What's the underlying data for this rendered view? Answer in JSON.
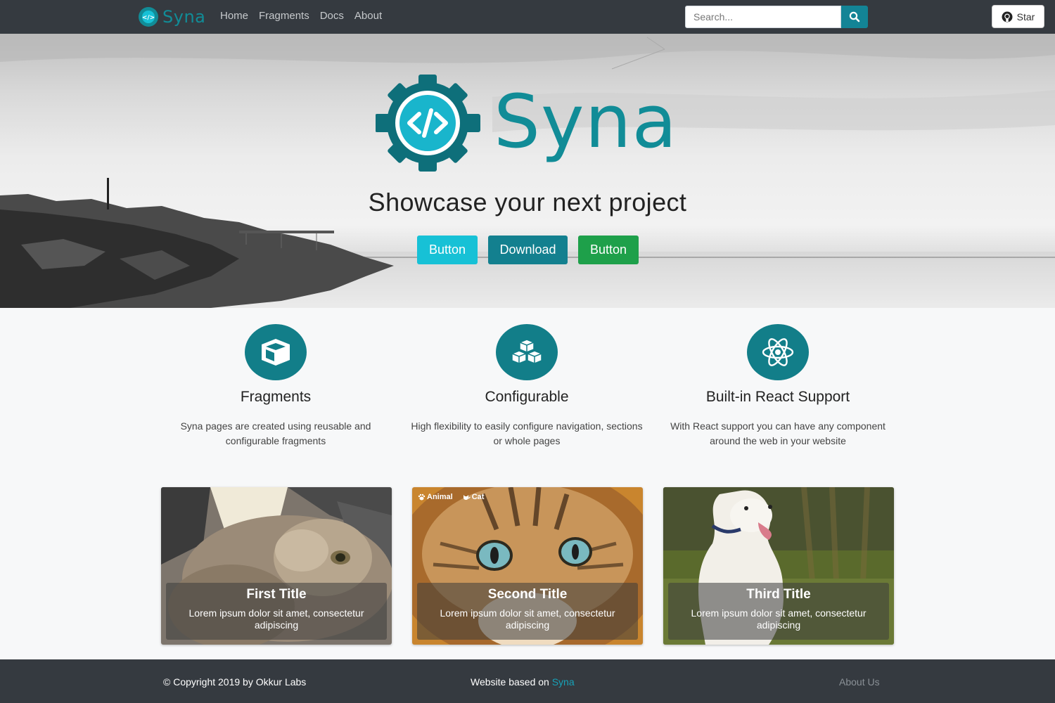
{
  "navbar": {
    "brand": "Syna",
    "links": [
      "Home",
      "Fragments",
      "Docs",
      "About"
    ],
    "search_placeholder": "Search...",
    "star_label": "Star"
  },
  "hero": {
    "logo_text": "Syna",
    "tagline": "Showcase your next project",
    "buttons": [
      "Button",
      "Download",
      "Button"
    ]
  },
  "features": [
    {
      "icon": "cube-icon",
      "title": "Fragments",
      "desc": "Syna pages are created using reusable and configurable fragments"
    },
    {
      "icon": "cubes-icon",
      "title": "Configurable",
      "desc": "High flexibility to easily configure navigation, sections or whole pages"
    },
    {
      "icon": "react-icon",
      "title": "Built-in React Support",
      "desc": "With React support you can have any component around the web in your website"
    }
  ],
  "cards": [
    {
      "title": "First Title",
      "text": "Lorem ipsum dolor sit amet, consectetur adipiscing",
      "tags": []
    },
    {
      "title": "Second Title",
      "text": "Lorem ipsum dolor sit amet, consectetur adipiscing",
      "tags": [
        "Animal",
        "Cat"
      ]
    },
    {
      "title": "Third Title",
      "text": "Lorem ipsum dolor sit amet, consectetur adipiscing",
      "tags": []
    }
  ],
  "footer": {
    "copyright": "© Copyright 2019 by Okkur Labs",
    "based_on": "Website based on ",
    "based_link": "Syna",
    "about": "About Us"
  },
  "colors": {
    "navbar": "#353a40",
    "brand": "#118c97",
    "accent": "#127e89",
    "info": "#17c1d6",
    "success": "#1ea04a"
  }
}
